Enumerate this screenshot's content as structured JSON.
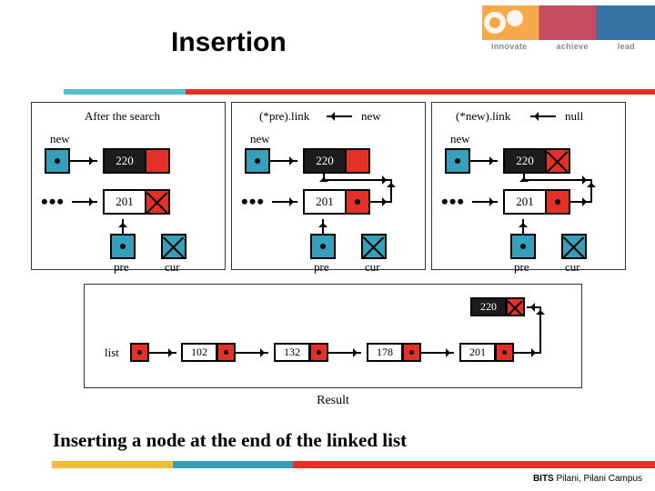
{
  "title": "Insertion",
  "header_tags": [
    "innovate",
    "achieve",
    "lead"
  ],
  "panels": {
    "a": {
      "heading": "After the search",
      "new_label": "new",
      "node_new": "220",
      "node_last": "201",
      "pre_label": "pre",
      "cur_label": "cur"
    },
    "b": {
      "heading_ptr": "(*pre).link",
      "heading_arrow_from": "new",
      "new_label": "new",
      "node_new": "220",
      "node_last": "201",
      "pre_label": "pre",
      "cur_label": "cur"
    },
    "c": {
      "heading_ptr": "(*new).link",
      "heading_arrow_from": "null",
      "new_label": "new",
      "node_new": "220",
      "node_last": "201",
      "pre_label": "pre",
      "cur_label": "cur"
    }
  },
  "result": {
    "label": "Result",
    "list_label": "list",
    "nodes": [
      "102",
      "132",
      "178",
      "201"
    ],
    "inserted": "220"
  },
  "subtitle": "Inserting a node at the end of the linked list",
  "footer": {
    "bold": "BITS",
    "rest": " Pilani, Pilani Campus"
  }
}
